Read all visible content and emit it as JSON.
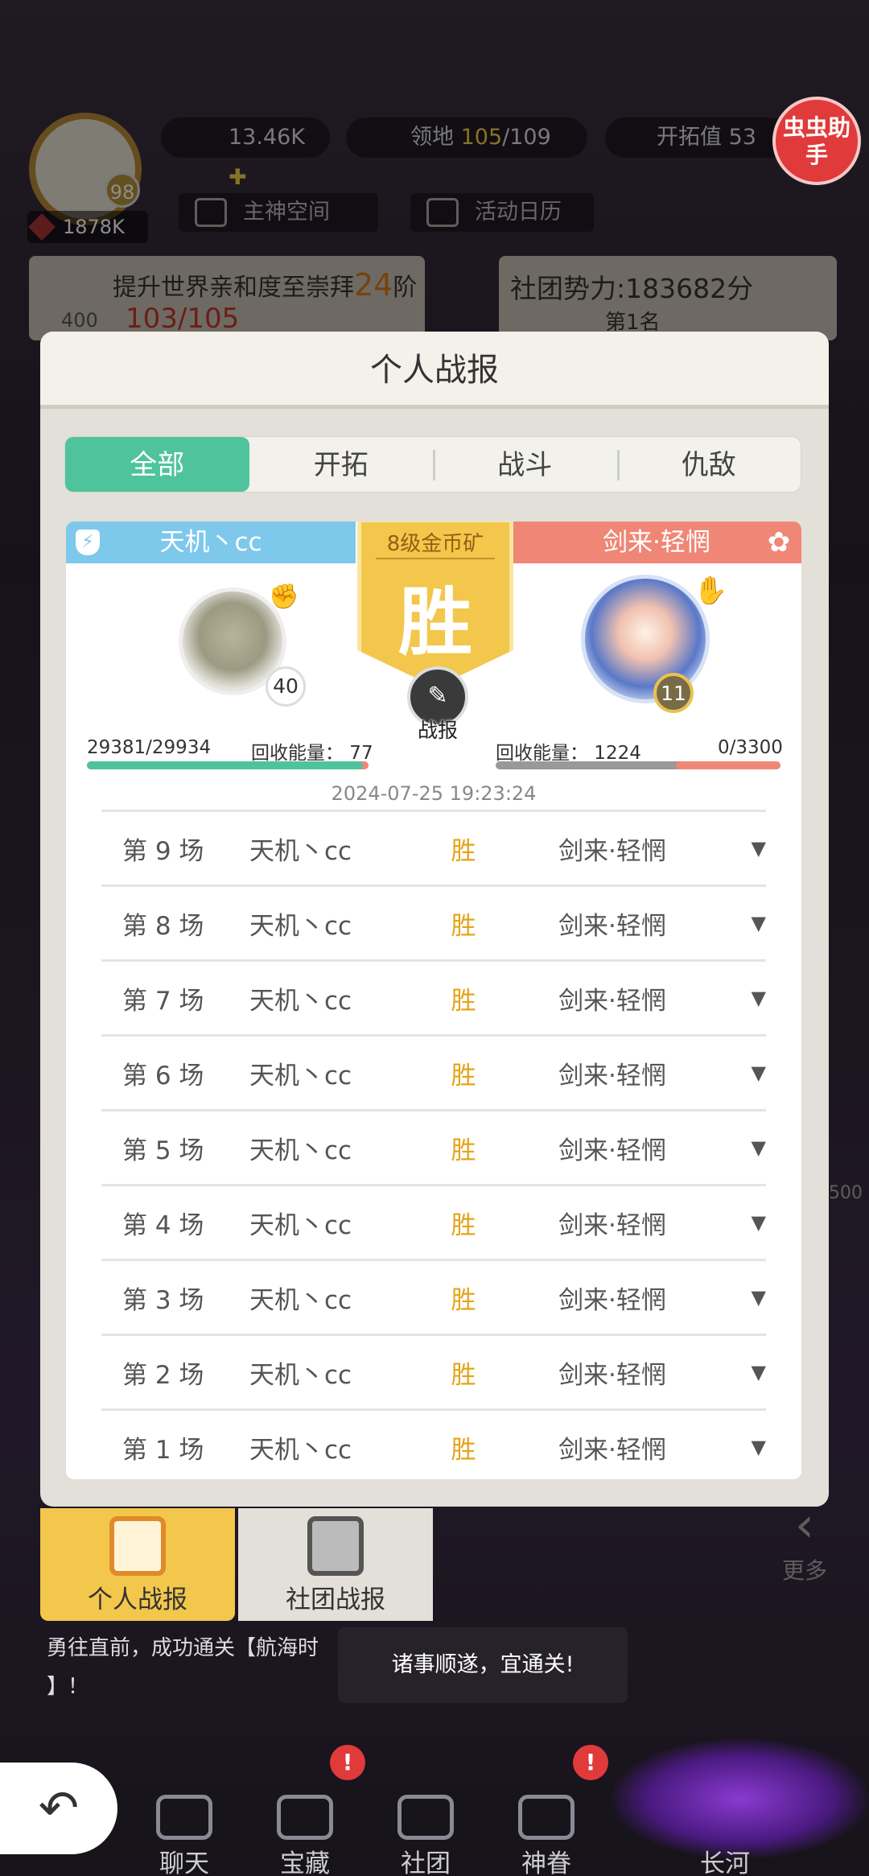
{
  "hud": {
    "level": "98",
    "power": "1878K",
    "gold": "13.46K",
    "territory_label": "领地",
    "territory_cur": "105",
    "territory_max": "/109",
    "explore_label": "开拓值",
    "explore_value": "53",
    "btn_space": "主神空间",
    "btn_calendar": "活动日历",
    "quest_text": "提升世界亲和度至崇拜",
    "quest_num": "24",
    "quest_unit": "阶",
    "quest_reward": "400",
    "quest_progress": "103/105",
    "guild_power": "社团势力:183682分",
    "guild_rank": "第1名",
    "helper": "虫虫助手",
    "side_value": "500",
    "more": "更多"
  },
  "panel": {
    "title": "个人战报",
    "tabs": [
      "全部",
      "开拓",
      "战斗",
      "仇敌"
    ],
    "battle": {
      "left_name": "天机丶cc",
      "right_name": "剑来·轻惘",
      "left_level": "40",
      "right_level": "11",
      "mine": "8级金币矿",
      "result": "胜",
      "report_label": "战报",
      "left_hp": "29381/29934",
      "left_recycle": "回收能量：  77",
      "right_recycle": "回收能量：  1224",
      "right_hp": "0/3300",
      "left_hp_fraction": 0.98,
      "right_hp_fraction": 0.0,
      "timestamp": "2024-07-25 19:23:24"
    },
    "rows": [
      {
        "round": "第 9 场",
        "a": "天机丶cc",
        "r": "胜",
        "b": "剑来·轻惘"
      },
      {
        "round": "第 8 场",
        "a": "天机丶cc",
        "r": "胜",
        "b": "剑来·轻惘"
      },
      {
        "round": "第 7 场",
        "a": "天机丶cc",
        "r": "胜",
        "b": "剑来·轻惘"
      },
      {
        "round": "第 6 场",
        "a": "天机丶cc",
        "r": "胜",
        "b": "剑来·轻惘"
      },
      {
        "round": "第 5 场",
        "a": "天机丶cc",
        "r": "胜",
        "b": "剑来·轻惘"
      },
      {
        "round": "第 4 场",
        "a": "天机丶cc",
        "r": "胜",
        "b": "剑来·轻惘"
      },
      {
        "round": "第 3 场",
        "a": "天机丶cc",
        "r": "胜",
        "b": "剑来·轻惘"
      },
      {
        "round": "第 2 场",
        "a": "天机丶cc",
        "r": "胜",
        "b": "剑来·轻惘"
      },
      {
        "round": "第 1 场",
        "a": "天机丶cc",
        "r": "胜",
        "b": "剑来·轻惘"
      }
    ]
  },
  "bottom_tabs": {
    "personal": "个人战报",
    "guild": "社团战报"
  },
  "chat": {
    "line1": "勇往直前，成功通关【航海时",
    "line2": "】！"
  },
  "toast": "诸事顺遂，宜通关!",
  "nav": {
    "chat": "聊天",
    "treasure": "宝藏",
    "club": "社团",
    "favor": "神眷",
    "river": "长河"
  },
  "badge": "!"
}
